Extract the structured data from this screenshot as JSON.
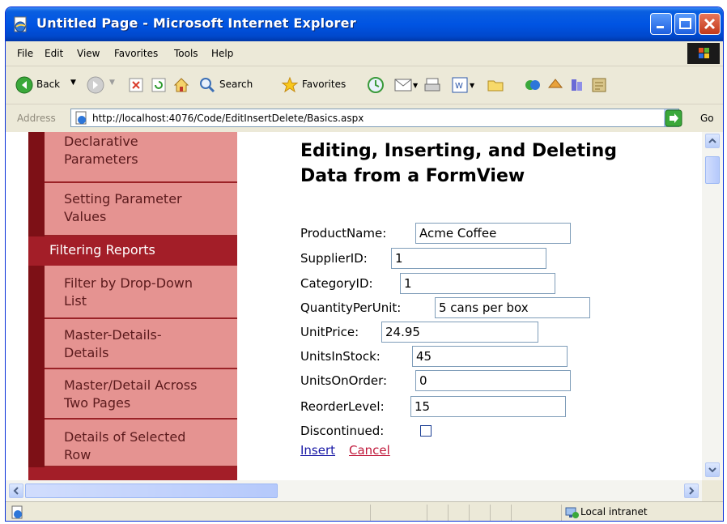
{
  "window": {
    "title": "Untitled Page - Microsoft Internet Explorer",
    "buttons": {
      "minimize": "minimize",
      "maximize": "maximize",
      "close": "close"
    }
  },
  "menubar": {
    "items": [
      {
        "label": "File"
      },
      {
        "label": "Edit"
      },
      {
        "label": "View"
      },
      {
        "label": "Favorites"
      },
      {
        "label": "Tools"
      },
      {
        "label": "Help"
      }
    ]
  },
  "toolbar": {
    "back_label": "Back",
    "search_label": "Search",
    "favorites_label": "Favorites"
  },
  "address": {
    "label": "Address",
    "url": "http://localhost:4076/Code/EditInsertDelete/Basics.aspx",
    "go_label": "Go"
  },
  "nav": {
    "items": [
      {
        "label_line1": "Declarative",
        "label_line2": "Parameters"
      },
      {
        "label_line1": "Setting Parameter",
        "label_line2": "Values"
      },
      {
        "label_line1": "Filter by Drop-Down",
        "label_line2": "List"
      },
      {
        "label_line1": "Master-Details-",
        "label_line2": "Details"
      },
      {
        "label_line1": "Master/Detail Across",
        "label_line2": "Two Pages"
      },
      {
        "label_line1": "Details of Selected",
        "label_line2": "Row"
      }
    ],
    "section": "Filtering Reports"
  },
  "page": {
    "title_line1": "Editing, Inserting, and Deleting",
    "title_line2": "Data from a FormView"
  },
  "form": {
    "fields": [
      {
        "label": "ProductName:",
        "value": "Acme Coffee"
      },
      {
        "label": "SupplierID:",
        "value": "1"
      },
      {
        "label": "CategoryID:",
        "value": "1"
      },
      {
        "label": "QuantityPerUnit:",
        "value": "5 cans per box"
      },
      {
        "label": "UnitPrice:",
        "value": "24.95"
      },
      {
        "label": "UnitsInStock:",
        "value": "45"
      },
      {
        "label": "UnitsOnOrder:",
        "value": "0"
      },
      {
        "label": "ReorderLevel:",
        "value": "15"
      }
    ],
    "discontinued_label": "Discontinued:",
    "discontinued_checked": false,
    "insert_label": "Insert",
    "cancel_label": "Cancel",
    "insert_color": "#1a1aa6",
    "cancel_color": "#c0183a"
  },
  "status": {
    "zone": "Local intranet"
  },
  "colors": {
    "titlebar": "#0054e3",
    "nav_item_bg": "#e59391",
    "nav_section_bg": "#a31e28",
    "nav_accent": "#7d1016"
  }
}
